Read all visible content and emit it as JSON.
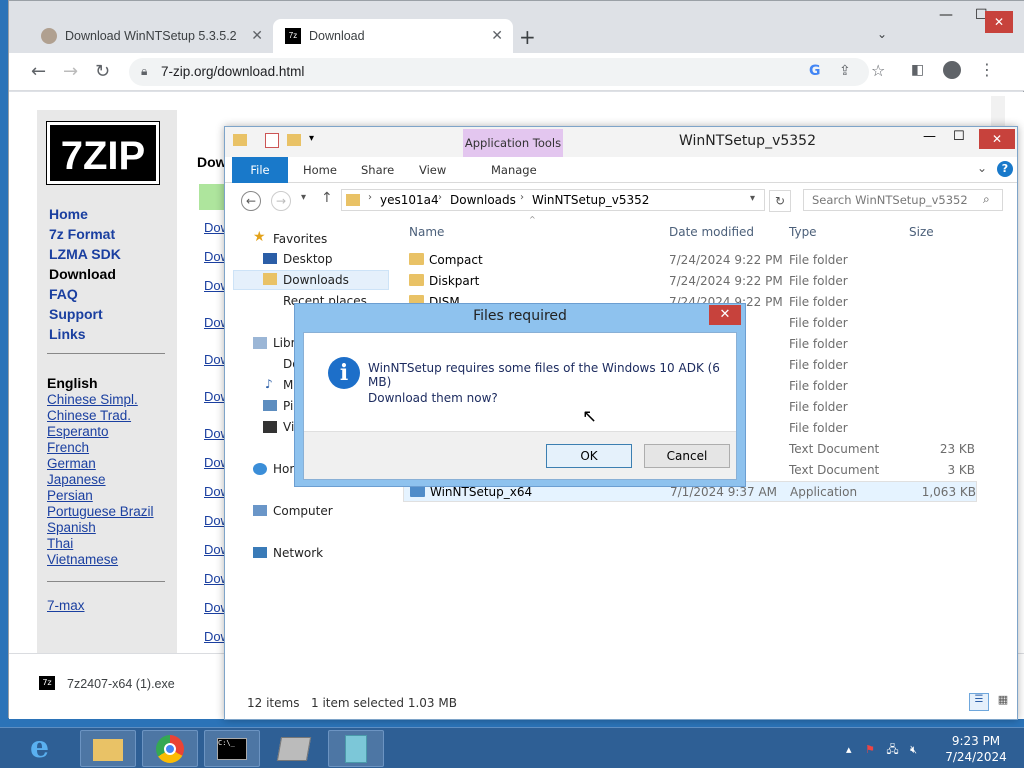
{
  "browser": {
    "tabs": [
      {
        "title": "Download WinNTSetup 5.3.5.2"
      },
      {
        "title": "Download"
      }
    ],
    "new_tab": "+",
    "url": "7-zip.org/download.html"
  },
  "site": {
    "logo_text": "7ZIP",
    "nav": [
      "Home",
      "7z Format",
      "LZMA SDK",
      "Download",
      "FAQ",
      "Support",
      "Links"
    ],
    "lang_title": "English",
    "languages": [
      "Chinese Simpl.",
      "Chinese Trad.",
      "Esperanto",
      "French",
      "German",
      "Japanese",
      "Persian",
      "Portuguese Brazil",
      "Spanish",
      "Thai",
      "Vietnamese"
    ],
    "extra_link": "7-max",
    "heading_fragment": "Dow",
    "download_link": "Dow"
  },
  "download_bar": {
    "file": "7z2407-x64 (1).exe"
  },
  "explorer": {
    "title": "WinNTSetup_v5352",
    "app_tools": "Application Tools",
    "ribbon_tabs": [
      "File",
      "Home",
      "Share",
      "View",
      "Manage"
    ],
    "breadcrumb": [
      "yes101a4",
      "Downloads",
      "WinNTSetup_v5352"
    ],
    "search_placeholder": "Search WinNTSetup_v5352",
    "nav": {
      "favorites": "Favorites",
      "desktop": "Desktop",
      "downloads": "Downloads",
      "recent": "Recent places",
      "libraries": "Libr",
      "lib_items": [
        "Do",
        "M",
        "Pi",
        "Vi"
      ],
      "homegroup": "Hor",
      "computer": "Computer",
      "network": "Network"
    },
    "columns": {
      "name": "Name",
      "date": "Date modified",
      "type": "Type",
      "size": "Size"
    },
    "files": [
      {
        "name": "Compact",
        "date": "7/24/2024 9:22 PM",
        "type": "File folder",
        "size": ""
      },
      {
        "name": "Diskpart",
        "date": "7/24/2024 9:22 PM",
        "type": "File folder",
        "size": ""
      },
      {
        "name": "DISM",
        "date": "7/24/2024 9:22 PM",
        "type": "File folder",
        "size": ""
      },
      {
        "name": "",
        "date": "PM",
        "type": "File folder",
        "size": ""
      },
      {
        "name": "",
        "date": "PM",
        "type": "File folder",
        "size": ""
      },
      {
        "name": "",
        "date": "PM",
        "type": "File folder",
        "size": ""
      },
      {
        "name": "",
        "date": "PM",
        "type": "File folder",
        "size": ""
      },
      {
        "name": "",
        "date": "PM",
        "type": "File folder",
        "size": ""
      },
      {
        "name": "",
        "date": "PM",
        "type": "File folder",
        "size": ""
      },
      {
        "name": "",
        "date": "AM",
        "type": "Text Document",
        "size": "23 KB"
      },
      {
        "name": "",
        "date": "AM",
        "type": "Text Document",
        "size": "3 KB"
      },
      {
        "name": "WinNTSetup_x64",
        "date": "7/1/2024 9:37 AM",
        "type": "Application",
        "size": "1,063 KB"
      }
    ],
    "status": {
      "items": "12 items",
      "selected": "1 item selected  1.03 MB"
    }
  },
  "dialog": {
    "title": "Files required",
    "close": "✕",
    "message": "WinNTSetup requires some files of the Windows 10 ADK (6 MB)",
    "question": "Download them now?",
    "ok": "OK",
    "cancel": "Cancel"
  },
  "taskbar": {
    "time": "9:23 PM",
    "date": "7/24/2024"
  },
  "colors": {
    "accent": "#1979ca",
    "link": "#1a3fa0",
    "taskbar": "#2e5f95",
    "close_red": "#c7423c"
  }
}
